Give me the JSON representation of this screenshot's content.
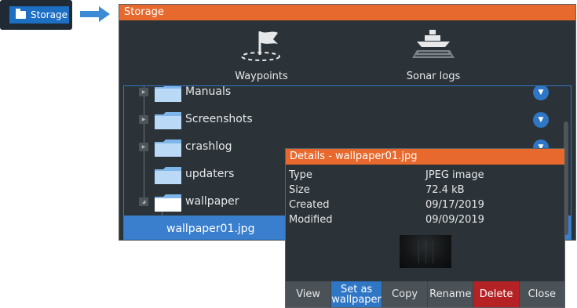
{
  "shortcut": {
    "label": "Storage",
    "icon": "folder-icon"
  },
  "window": {
    "title": "Storage",
    "top_icons": [
      {
        "label": "Waypoints",
        "icon": "waypoint-flag-icon"
      },
      {
        "label": "Sonar logs",
        "icon": "sonar-ship-icon"
      }
    ]
  },
  "files": [
    {
      "name": "Manuals",
      "type": "folder",
      "expandable": true
    },
    {
      "name": "Screenshots",
      "type": "folder",
      "expandable": true
    },
    {
      "name": "crashlog",
      "type": "folder",
      "expandable": true
    },
    {
      "name": "updaters",
      "type": "folder",
      "expandable": false
    },
    {
      "name": "wallpaper",
      "type": "folder",
      "expandable": true,
      "expanded": true
    },
    {
      "name": "wallpaper01.jpg",
      "type": "file",
      "selected": true
    }
  ],
  "details": {
    "title": "Details - wallpaper01.jpg",
    "rows": [
      {
        "key": "Type",
        "value": "JPEG image"
      },
      {
        "key": "Size",
        "value": "72.4 kB"
      },
      {
        "key": "Created",
        "value": "09/17/2019"
      },
      {
        "key": "Modified",
        "value": "09/09/2019"
      }
    ],
    "buttons": [
      "View",
      "Set as wallpaper",
      "Copy",
      "Rename",
      "Delete",
      "Close"
    ]
  },
  "colors": {
    "accent": "#e8692d",
    "selection": "#2f76c5",
    "delete": "#b52225",
    "panel": "#2c3338"
  }
}
